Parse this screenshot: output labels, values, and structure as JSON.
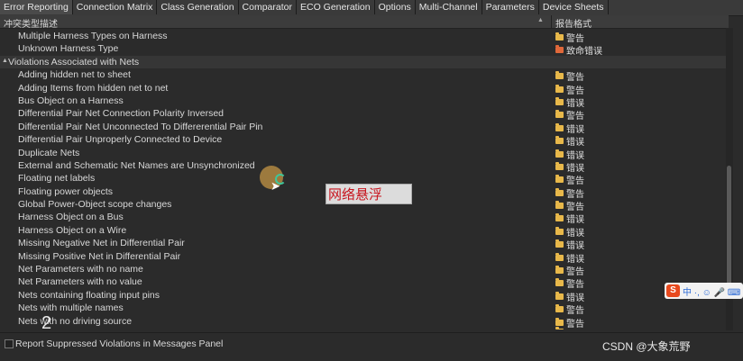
{
  "tabs": [
    {
      "label": "Error Reporting",
      "active": true
    },
    {
      "label": "Connection Matrix"
    },
    {
      "label": "Class Generation"
    },
    {
      "label": "Comparator"
    },
    {
      "label": "ECO Generation"
    },
    {
      "label": "Options"
    },
    {
      "label": "Multi-Channel"
    },
    {
      "label": "Parameters"
    },
    {
      "label": "Device Sheets"
    }
  ],
  "table": {
    "col1_header": "冲突类型描述",
    "col2_header": "报告格式",
    "rows": [
      {
        "text": "Multiple Harness Types on Harness",
        "report": "警告",
        "level": "warning"
      },
      {
        "text": "Unknown Harness Type",
        "report": "致命错误",
        "level": "fatal"
      },
      {
        "text": "Violations Associated with Nets",
        "group": true
      },
      {
        "text": "Adding hidden net to sheet",
        "report": "警告",
        "level": "warning"
      },
      {
        "text": "Adding Items from hidden net to net",
        "report": "警告",
        "level": "warning"
      },
      {
        "text": "Bus Object on a Harness",
        "report": "错误",
        "level": "error"
      },
      {
        "text": "Differential Pair Net Connection Polarity Inversed",
        "report": "警告",
        "level": "warning"
      },
      {
        "text": "Differential Pair Net Unconnected To Differerential Pair Pin",
        "report": "错误",
        "level": "error"
      },
      {
        "text": "Differential Pair Unproperly Connected to Device",
        "report": "错误",
        "level": "error"
      },
      {
        "text": "Duplicate Nets",
        "report": "错误",
        "level": "error"
      },
      {
        "text": "External and Schematic Net Names are Unsynchronized",
        "report": "错误",
        "level": "error"
      },
      {
        "text": "Floating net labels",
        "report": "警告",
        "level": "warning"
      },
      {
        "text": "Floating power objects",
        "report": "警告",
        "level": "warning"
      },
      {
        "text": "Global Power-Object scope changes",
        "report": "警告",
        "level": "warning"
      },
      {
        "text": "Harness Object on a Bus",
        "report": "错误",
        "level": "error"
      },
      {
        "text": "Harness Object on a Wire",
        "report": "错误",
        "level": "error"
      },
      {
        "text": "Missing Negative Net in Differential Pair",
        "report": "错误",
        "level": "error"
      },
      {
        "text": "Missing Positive Net in Differential Pair",
        "report": "错误",
        "level": "error"
      },
      {
        "text": "Net Parameters with no name",
        "report": "警告",
        "level": "warning"
      },
      {
        "text": "Net Parameters with no value",
        "report": "警告",
        "level": "warning"
      },
      {
        "text": "Nets containing floating input pins",
        "report": "错误",
        "level": "error"
      },
      {
        "text": "Nets with multiple names",
        "report": "警告",
        "level": "warning"
      },
      {
        "text": "Nets with no driving source",
        "report": "警告",
        "level": "warning"
      },
      {
        "text": "",
        "report": "",
        "level": "error"
      }
    ]
  },
  "footer": {
    "checkbox_label": "Report Suppressed Violations in Messages Panel",
    "checked": false,
    "watermark": "CSDN @大象荒野"
  },
  "tooltip": {
    "text": "网络悬浮"
  },
  "ime": {
    "logo": "S",
    "label": "中 ·, ☺ 🎤 ⌨"
  },
  "stray_text": "2",
  "colors": {
    "background": "#2b2b2b",
    "warning_folder": "#e8b84a",
    "fatal_folder": "#e0683a",
    "tooltip_text": "#c8141e"
  }
}
